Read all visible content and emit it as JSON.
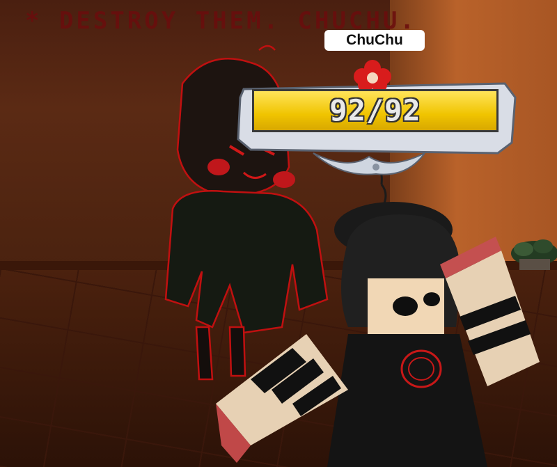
{
  "banner_text": "* DESTROY THEM. CHUCHU.",
  "player": {
    "name": "ChuChu",
    "hp_current": 92,
    "hp_max": 92,
    "hp_text": "92/92",
    "hp_fraction": 1.0
  },
  "colors": {
    "banner": "#6b0d0d",
    "hp_fill": "#f0c400",
    "hp_text": "#e9e9e9",
    "flower": "#d81c1c"
  },
  "icons": [
    "flower-icon",
    "frame-ornament-icon"
  ]
}
